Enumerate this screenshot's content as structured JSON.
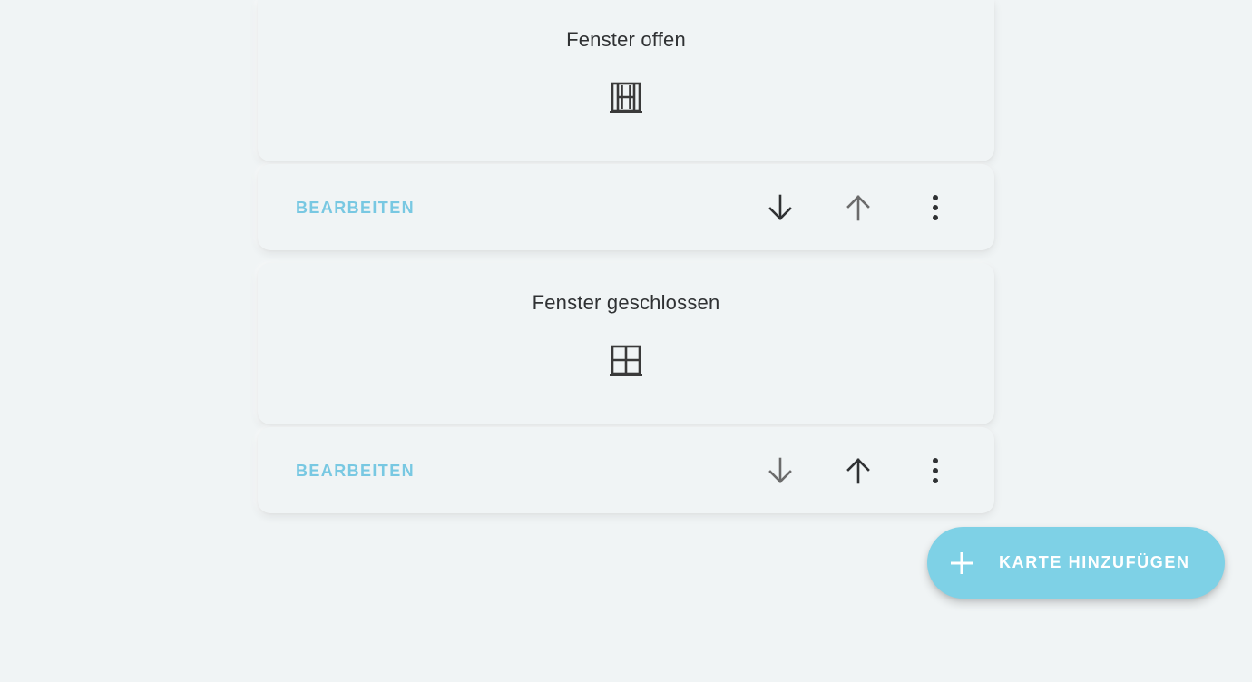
{
  "cards": [
    {
      "title": "Fenster offen",
      "icon": "window-open-icon",
      "edit_label": "BEARBEITEN"
    },
    {
      "title": "Fenster geschlossen",
      "icon": "window-closed-icon",
      "edit_label": "BEARBEITEN"
    }
  ],
  "fab": {
    "label": "KARTE HINZUFÜGEN",
    "icon": "plus-icon"
  },
  "colors": {
    "background": "#f0f4f5",
    "accent": "#78c8e2",
    "fab": "#7ed1e6",
    "text": "#2f3133",
    "icon": "#3a3a3a",
    "icon_disabled": "#6b6b6b"
  }
}
